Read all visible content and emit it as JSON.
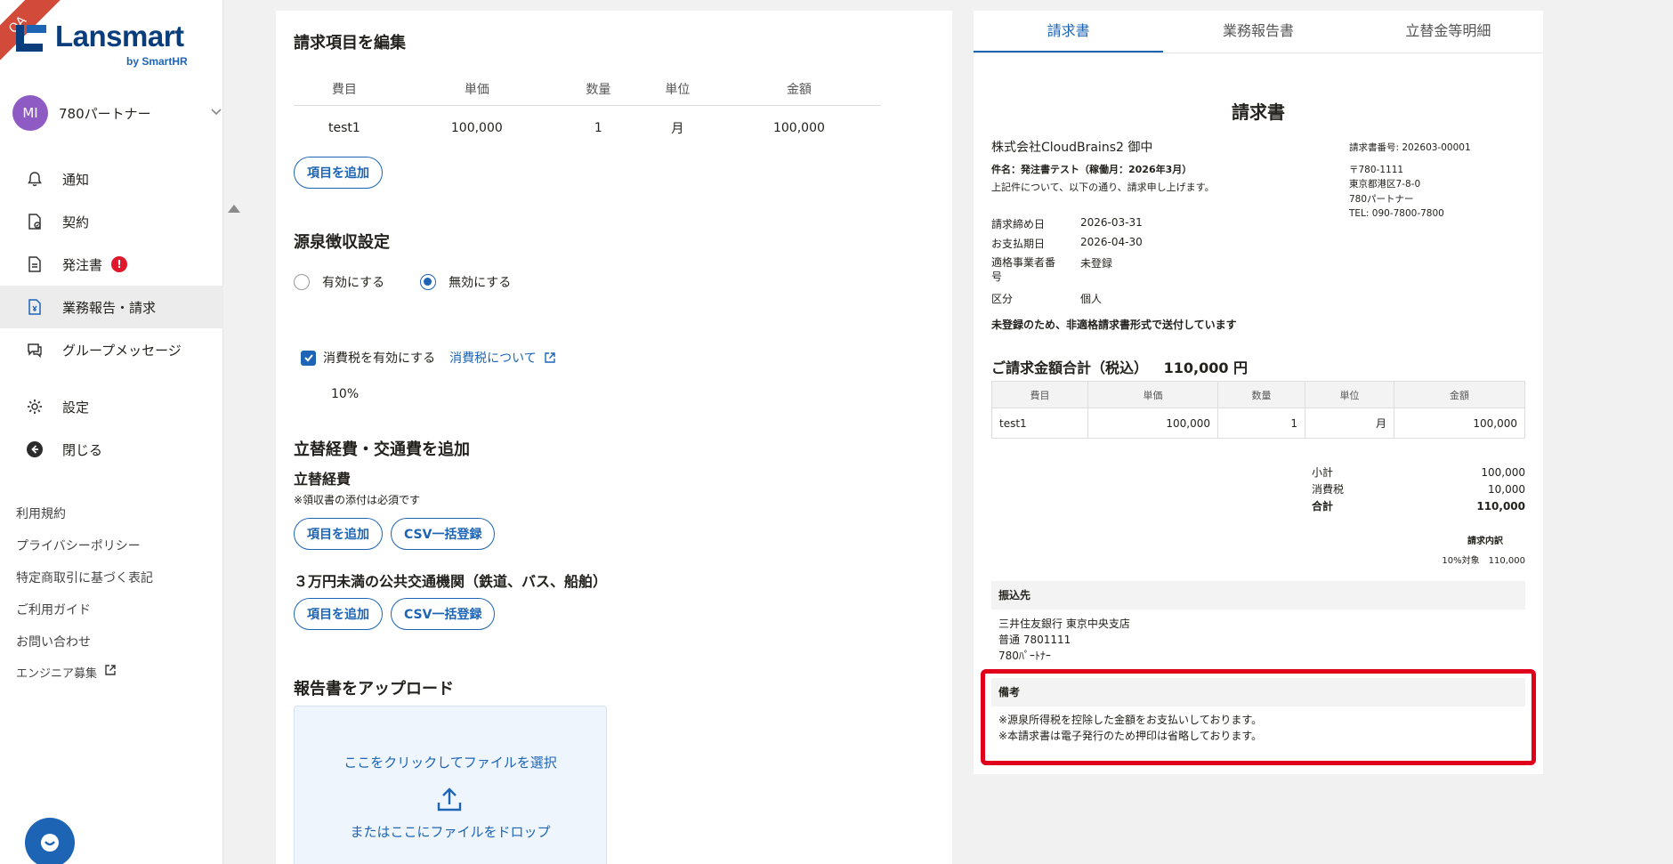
{
  "qa_label": "QA",
  "brand": {
    "name": "Lansmart",
    "sub": "by SmartHR"
  },
  "account": {
    "initials": "MI",
    "name": "780パートナー"
  },
  "nav": [
    {
      "label": "通知",
      "icon": "bell-icon"
    },
    {
      "label": "契約",
      "icon": "contract-icon"
    },
    {
      "label": "発注書",
      "icon": "document-icon",
      "badge": "!"
    },
    {
      "label": "業務報告・請求",
      "icon": "invoice-icon",
      "active": true
    },
    {
      "label": "グループメッセージ",
      "icon": "chat-icon"
    },
    {
      "label": "設定",
      "icon": "gear-icon"
    },
    {
      "label": "閉じる",
      "icon": "collapse-icon"
    }
  ],
  "footer_links": [
    "利用規約",
    "プライバシーポリシー",
    "特定商取引に基づく表記",
    "ご利用ガイド",
    "お問い合わせ",
    "エンジニア募集"
  ],
  "editor": {
    "title": "請求項目を編集",
    "columns": [
      "費目",
      "単価",
      "数量",
      "単位",
      "金額"
    ],
    "rows": [
      [
        "test1",
        "100,000",
        "1",
        "月",
        "100,000"
      ]
    ],
    "add_item": "項目を追加",
    "withholding_title": "源泉徴収設定",
    "radio_enable": "有効にする",
    "radio_disable": "無効にする",
    "tax_checkbox": "消費税を有効にする",
    "tax_link": "消費税について",
    "tax_rate": "10%",
    "expenses_title": "立替経費・交通費を追加",
    "expenses_sub": "立替経費",
    "receipt_note": "※領収書の添付は必須です",
    "csv_button": "CSV一括登録",
    "transit_title": "３万円未満の公共交通機関（鉄道、バス、船舶）",
    "upload_title": "報告書をアップロード",
    "upload_click": "ここをクリックしてファイルを選択",
    "upload_drop": "またはここにファイルをドロップ"
  },
  "preview": {
    "tabs": [
      "請求書",
      "業務報告書",
      "立替金等明細"
    ],
    "title": "請求書",
    "client": "株式会社CloudBrains2 御中",
    "subject": "件名：発注書テスト（稼働月：2026年3月）",
    "lead": "上記件について、以下の通り、請求申し上げます。",
    "issuer": [
      "請求書番号: 202603-00001",
      "",
      "〒780-1111",
      "東京都港区7-8-0",
      "780パートナー",
      "TEL: 090-7800-7800"
    ],
    "meta": [
      {
        "k": "請求締め日",
        "v": "2026-03-31"
      },
      {
        "k": "お支払期日",
        "v": "2026-04-30"
      },
      {
        "k": "適格事業者番号",
        "v": "未登録"
      },
      {
        "k": "区分",
        "v": "個人"
      }
    ],
    "nonqualified_note": "未登録のため、非適格請求書形式で送付しています",
    "total_label": "ご請求金額合計（税込）",
    "total_value": "110,000 円",
    "table_columns": [
      "費目",
      "単価",
      "数量",
      "単位",
      "金額"
    ],
    "table_rows": [
      [
        "test1",
        "100,000",
        "1",
        "月",
        "100,000"
      ]
    ],
    "summary": [
      {
        "k": "小計",
        "v": "100,000"
      },
      {
        "k": "消費税",
        "v": "10,000"
      },
      {
        "k": "合計",
        "v": "110,000"
      }
    ],
    "breakdown_title": "請求内訳",
    "breakdown_line": "10%対象　110,000",
    "bank_title": "振込先",
    "bank_lines": [
      "三井住友銀行 東京中央支店",
      "普通 7801111",
      "780ﾊﾟｰﾄﾅｰ"
    ],
    "remarks_title": "備考",
    "remarks_lines": [
      "※源泉所得税を控除した金額をお支払いしております。",
      "※本請求書は電子発行のため押印は省略しております。"
    ]
  },
  "colors": {
    "brand": "#1d64b5",
    "logo": "#0a3d7c",
    "highlight": "#e0001b",
    "badge": "#e0182d"
  }
}
